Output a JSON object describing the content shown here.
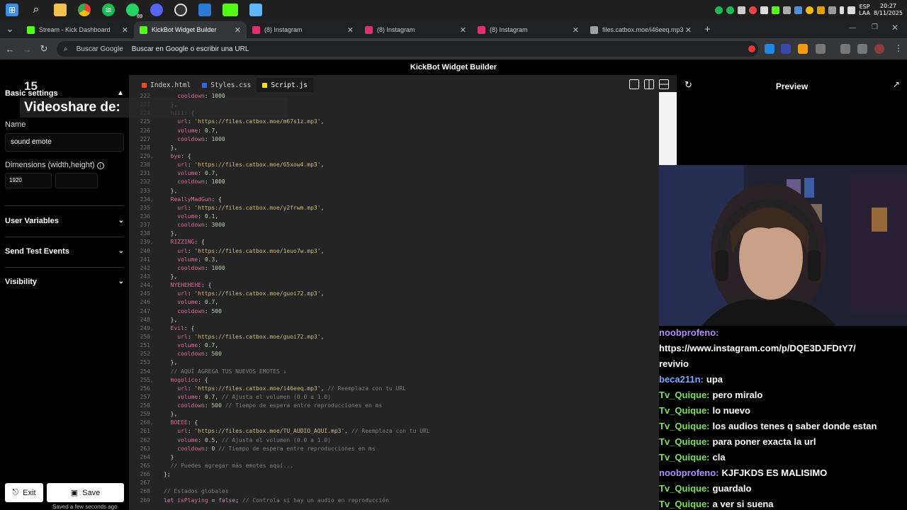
{
  "taskbar": {
    "icons": [
      "windows-icon",
      "search-icon",
      "file-explorer-icon",
      "chrome-icon",
      "spotify-icon",
      "whatsapp-icon",
      "discord-icon",
      "obs-icon",
      "app-icon",
      "kick-icon",
      "notepad-icon"
    ],
    "whatsapp_badge": "69",
    "lang_top": "ESP",
    "lang_bottom": "LAA",
    "time": "20:27",
    "date": "8/11/2025"
  },
  "tabs": [
    {
      "label": "Stream - Kick Dashboard",
      "color": "#53fc18"
    },
    {
      "label": "KickBot Widget Builder",
      "color": "#53fc18"
    },
    {
      "label": "(8) Instagram",
      "color": "#e1306c"
    },
    {
      "label": "(8) Instagram",
      "color": "#e1306c"
    },
    {
      "label": "(8) Instagram",
      "color": "#e1306c"
    },
    {
      "label": "files.catbox.moe/i46eeq.mp3",
      "color": "#9aa0a6"
    }
  ],
  "omnibox": {
    "engine": "Buscar Google",
    "placeholder": "Buscar en Google o escribir una URL"
  },
  "app": {
    "title": "KickBot Widget Builder"
  },
  "sidebar": {
    "basic_settings": "Basic settings",
    "name_label": "Name",
    "name_value": "sound emote",
    "dimensions_label": "Dimensions (width,height)",
    "width_value": "1920",
    "user_variables": "User Variables",
    "send_test_events": "Send Test Events",
    "visibility": "Visibility",
    "exit_label": "Exit",
    "save_label": "Save",
    "saved_text": "Saved a few seconds ago"
  },
  "overlay": {
    "count": "15",
    "text": "Videoshare de:"
  },
  "editor": {
    "tabs": [
      {
        "label": "Index.html",
        "color": "#e44d26"
      },
      {
        "label": "Styles.css",
        "color": "#2965f1"
      },
      {
        "label": "Script.js",
        "color": "#f7df1e"
      }
    ],
    "lines": [
      {
        "n": "222",
        "fold": "",
        "html": "    <span class='k'>cooldown</span>: <span class='n'>1000</span>"
      },
      {
        "n": "223",
        "fold": "",
        "html": "  },"
      },
      {
        "n": "224",
        "fold": "⌄",
        "html": "  <span class='k'>hiii</span>: {"
      },
      {
        "n": "225",
        "fold": "",
        "html": "    <span class='k'>url</span>: <span class='s'>'https://files.catbox.moe/m67s1z.mp3'</span>,"
      },
      {
        "n": "226",
        "fold": "",
        "html": "    <span class='k'>volume</span>: <span class='n'>0.7</span>,"
      },
      {
        "n": "227",
        "fold": "",
        "html": "    <span class='k'>cooldown</span>: <span class='n'>1000</span>"
      },
      {
        "n": "228",
        "fold": "",
        "html": "  },"
      },
      {
        "n": "229",
        "fold": "⌄",
        "html": "  <span class='k'>bye</span>: {"
      },
      {
        "n": "230",
        "fold": "",
        "html": "    <span class='k'>url</span>: <span class='s'>'https://files.catbox.moe/65xow4.mp3'</span>,"
      },
      {
        "n": "231",
        "fold": "",
        "html": "    <span class='k'>volume</span>: <span class='n'>0.7</span>,"
      },
      {
        "n": "232",
        "fold": "",
        "html": "    <span class='k'>cooldown</span>: <span class='n'>1000</span>"
      },
      {
        "n": "233",
        "fold": "",
        "html": "  },"
      },
      {
        "n": "234",
        "fold": "⌄",
        "html": "  <span class='k'>ReallyMadGun</span>: {"
      },
      {
        "n": "235",
        "fold": "",
        "html": "    <span class='k'>url</span>: <span class='s'>'https://files.catbox.moe/y2frwm.mp3'</span>,"
      },
      {
        "n": "236",
        "fold": "",
        "html": "    <span class='k'>volume</span>: <span class='n'>0.1</span>,"
      },
      {
        "n": "237",
        "fold": "",
        "html": "    <span class='k'>cooldown</span>: <span class='n'>3000</span>"
      },
      {
        "n": "238",
        "fold": "",
        "html": "  },"
      },
      {
        "n": "239",
        "fold": "⌄",
        "html": "  <span class='k'>RIZZING</span>: {"
      },
      {
        "n": "240",
        "fold": "",
        "html": "    <span class='k'>url</span>: <span class='s'>'https://files.catbox.moe/1euo7w.mp3'</span>,"
      },
      {
        "n": "241",
        "fold": "",
        "html": "    <span class='k'>volume</span>: <span class='n'>0.3</span>,"
      },
      {
        "n": "242",
        "fold": "",
        "html": "    <span class='k'>cooldown</span>: <span class='n'>1000</span>"
      },
      {
        "n": "243",
        "fold": "",
        "html": "  },"
      },
      {
        "n": "244",
        "fold": "⌄",
        "html": "  <span class='k'>NYEHEHEHE</span>: {"
      },
      {
        "n": "245",
        "fold": "",
        "html": "    <span class='k'>url</span>: <span class='s'>'https://files.catbox.moe/guoi72.mp3'</span>,"
      },
      {
        "n": "246",
        "fold": "",
        "html": "    <span class='k'>volume</span>: <span class='n'>0.7</span>,"
      },
      {
        "n": "247",
        "fold": "",
        "html": "    <span class='k'>cooldown</span>: <span class='n'>500</span>"
      },
      {
        "n": "248",
        "fold": "",
        "html": "  },"
      },
      {
        "n": "249",
        "fold": "⌄",
        "html": "  <span class='k'>Evil</span>: {"
      },
      {
        "n": "250",
        "fold": "",
        "html": "    <span class='k'>url</span>: <span class='s'>'https://files.catbox.moe/guoi72.mp3'</span>,"
      },
      {
        "n": "251",
        "fold": "",
        "html": "    <span class='k'>volume</span>: <span class='n'>0.7</span>,"
      },
      {
        "n": "252",
        "fold": "",
        "html": "    <span class='k'>cooldown</span>: <span class='n'>500</span>"
      },
      {
        "n": "253",
        "fold": "",
        "html": "  },"
      },
      {
        "n": "254",
        "fold": "",
        "html": "  <span class='c'>// AQUÍ AGREGA TUS NUEVOS EMOTES ↓</span>"
      },
      {
        "n": "255",
        "fold": "⌄",
        "html": "  <span class='k'>mogolico</span>: {"
      },
      {
        "n": "256",
        "fold": "",
        "html": "    <span class='k'>url</span>: <span class='s'>'https://files.catbox.moe/i46eeq.mp3'</span>, <span class='c'>// Reemplaza con tu URL</span>"
      },
      {
        "n": "257",
        "fold": "",
        "html": "    <span class='k'>volume</span>: <span class='n'>0.7</span>, <span class='c'>// Ajusta el volumen (0.0 a 1.0)</span>"
      },
      {
        "n": "258",
        "fold": "",
        "html": "    <span class='k'>cooldown</span>: <span class='n'>500</span> <span class='c'>// Tiempo de espera entre reproducciones en ms</span>"
      },
      {
        "n": "259",
        "fold": "",
        "html": "  },"
      },
      {
        "n": "260",
        "fold": "⌄",
        "html": "  <span class='k'>BOEEE</span>: {"
      },
      {
        "n": "261",
        "fold": "",
        "html": "    <span class='k'>url</span>: <span class='s'>'https://files.catbox.moe/TU_AUDIO_AQUI.mp3'</span>, <span class='c'>// Reemplaza con tu URL</span>"
      },
      {
        "n": "262",
        "fold": "",
        "html": "    <span class='k'>volume</span>: <span class='n'>0.5</span>, <span class='c'>// Ajusta el volumen (0.0 a 1.0)</span>"
      },
      {
        "n": "263",
        "fold": "",
        "html": "    <span class='k'>cooldown</span>: <span class='n'>0</span> <span class='c'>// Tiempo de espera entre reproducciones en ms</span>"
      },
      {
        "n": "264",
        "fold": "",
        "html": "  }"
      },
      {
        "n": "265",
        "fold": "",
        "html": "  <span class='c'>// Puedes agregar más emotes aquí...</span>"
      },
      {
        "n": "266",
        "fold": "",
        "html": "};"
      },
      {
        "n": "267",
        "fold": "",
        "html": ""
      },
      {
        "n": "268",
        "fold": "",
        "html": "<span class='c'>// Estados globales</span>"
      },
      {
        "n": "269",
        "fold": "",
        "html": "<span class='kw'>let</span> <span class='k'>isPlaying</span> = <span class='kw'>false</span>; <span class='c'>// Controla si hay un audio en reproducción</span>"
      }
    ]
  },
  "preview": {
    "title": "Preview"
  },
  "chat": [
    {
      "name": "noobprofeno:",
      "message": "",
      "color": "#b48cff"
    },
    {
      "name": "",
      "message": "https://www.instagram.com/p/DQE3DJFDtY7/",
      "color": "#fff"
    },
    {
      "name": "",
      "message": "revivio",
      "color": "#fff"
    },
    {
      "name": "beca211n:",
      "message": "upa",
      "color": "#7aa7ff"
    },
    {
      "name": "Tv_Quique:",
      "message": "pero miralo",
      "color": "#7ee05a"
    },
    {
      "name": "Tv_Quique:",
      "message": "lo nuevo",
      "color": "#7ee05a"
    },
    {
      "name": "Tv_Quique:",
      "message": "los audios tenes q saber donde estan",
      "color": "#7ee05a"
    },
    {
      "name": "Tv_Quique:",
      "message": "para poner exacta la url",
      "color": "#7ee05a"
    },
    {
      "name": "Tv_Quique:",
      "message": "cla",
      "color": "#7ee05a"
    },
    {
      "name": "noobprofeno:",
      "message": "KJFJKDS ES MALISIMO",
      "color": "#b48cff"
    },
    {
      "name": "Tv_Quique:",
      "message": "guardalo",
      "color": "#7ee05a"
    },
    {
      "name": "Tv_Quique:",
      "message": "a ver si suena",
      "color": "#7ee05a"
    }
  ]
}
